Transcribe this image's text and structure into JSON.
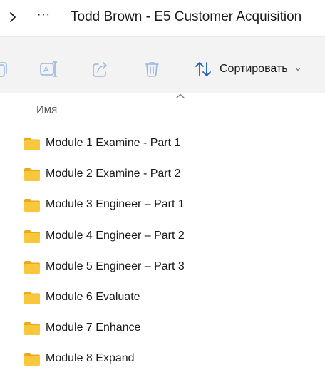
{
  "address": {
    "more_label": "···",
    "breadcrumb": "Todd Brown - E5 Customer Acquisition"
  },
  "toolbar": {
    "buttons": [
      {
        "name": "copy",
        "icon": "copy-icon"
      },
      {
        "name": "rename",
        "icon": "rename-icon"
      },
      {
        "name": "share",
        "icon": "share-icon"
      },
      {
        "name": "delete",
        "icon": "trash-icon"
      }
    ],
    "sort": {
      "label": "Сортировать",
      "icon": "sort-arrows-icon"
    }
  },
  "list": {
    "column_name": "Имя",
    "items": [
      {
        "label": "Module 1 Examine - Part 1"
      },
      {
        "label": "Module 2 Examine - Part 2"
      },
      {
        "label": "Module 3 Engineer – Part 1"
      },
      {
        "label": "Module 4 Engineer – Part 2"
      },
      {
        "label": "Module 5 Engineer – Part 3"
      },
      {
        "label": "Module 6 Evaluate"
      },
      {
        "label": "Module 7 Enhance"
      },
      {
        "label": "Module 8 Expand"
      }
    ]
  },
  "colors": {
    "toolbar_bg": "#f3f3f3",
    "icon_disabled": "#9ab7e0",
    "sort_icon": "#1f5fb8",
    "folder_body": "#f8c73c",
    "folder_tab": "#e9a91a"
  }
}
